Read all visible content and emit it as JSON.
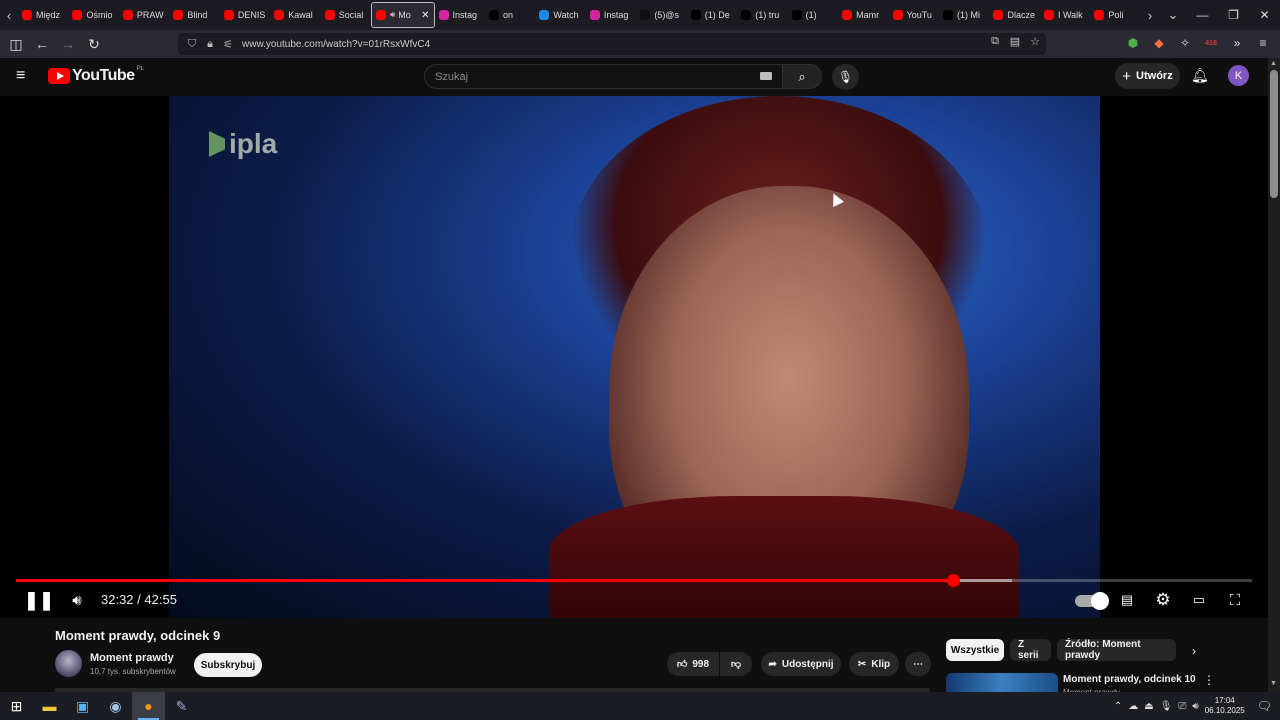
{
  "browser": {
    "tabs": [
      {
        "label": "Międz",
        "favicon": "youtube-icon",
        "color": "#ff0000"
      },
      {
        "label": "Ośmio",
        "favicon": "youtube-icon",
        "color": "#ff0000"
      },
      {
        "label": "PRAW",
        "favicon": "youtube-icon",
        "color": "#ff0000"
      },
      {
        "label": "Blind",
        "favicon": "youtube-icon",
        "color": "#ff0000"
      },
      {
        "label": "DENIS",
        "favicon": "youtube-icon",
        "color": "#ff0000"
      },
      {
        "label": "Kawal",
        "favicon": "youtube-icon",
        "color": "#ff0000"
      },
      {
        "label": "Social",
        "favicon": "youtube-icon",
        "color": "#ff0000"
      },
      {
        "label": "Mo",
        "favicon": "youtube-icon",
        "color": "#ff0000",
        "active": true
      },
      {
        "label": "Instag",
        "favicon": "instagram-icon",
        "color": "#d6249f"
      },
      {
        "label": "on",
        "favicon": "x-icon",
        "color": "#000000"
      },
      {
        "label": "Watch",
        "favicon": "watch-icon",
        "color": "#1e88e5"
      },
      {
        "label": "Instag",
        "favicon": "instagram-icon",
        "color": "#d6249f"
      },
      {
        "label": "(5)@s",
        "favicon": "tiktok-icon",
        "color": "#111111"
      },
      {
        "label": "(1) De",
        "favicon": "x-icon",
        "color": "#000000"
      },
      {
        "label": "(1) tru",
        "favicon": "x-icon",
        "color": "#000000"
      },
      {
        "label": "(1)",
        "favicon": "x-icon",
        "color": "#000000"
      },
      {
        "label": "Mamr",
        "favicon": "youtube-icon",
        "color": "#ff0000"
      },
      {
        "label": "YouTu",
        "favicon": "youtube-icon",
        "color": "#ff0000"
      },
      {
        "label": "(1) Mi",
        "favicon": "x-icon",
        "color": "#000000"
      },
      {
        "label": "Dlacze",
        "favicon": "youtube-icon",
        "color": "#ff0000"
      },
      {
        "label": "I Walk",
        "favicon": "youtube-icon",
        "color": "#ff0000"
      },
      {
        "label": "Poli",
        "favicon": "youtube-icon",
        "color": "#ff0000"
      }
    ],
    "url": "www.youtube.com/watch?v=01rRsxWfvC4",
    "extension_badge": "418"
  },
  "youtube": {
    "logo_text": "YouTube",
    "country": "PL",
    "search_placeholder": "Szukaj",
    "create_label": "Utwórz",
    "avatar_letter": "K"
  },
  "player": {
    "watermark": "ipla",
    "current_time": "32:32",
    "duration": "42:55",
    "time_separator": "/",
    "played_fraction": 0.758,
    "loaded_fraction": 0.806
  },
  "video": {
    "title": "Moment prawdy, odcinek 9",
    "channel": "Moment prawdy",
    "subscribers": "10,7 tys. subskrybentów",
    "subscribe_label": "Subskrybuj",
    "likes": "998",
    "share_label": "Udostępnij",
    "clip_label": "Klip"
  },
  "sidebar": {
    "chips": [
      "Wszystkie",
      "Z serii",
      "Źródło: Moment prawdy"
    ],
    "recommended": {
      "title": "Moment prawdy, odcinek 10",
      "channel": "Moment prawdy"
    }
  },
  "taskbar": {
    "time": "17:04",
    "date": "06.10.2025"
  }
}
